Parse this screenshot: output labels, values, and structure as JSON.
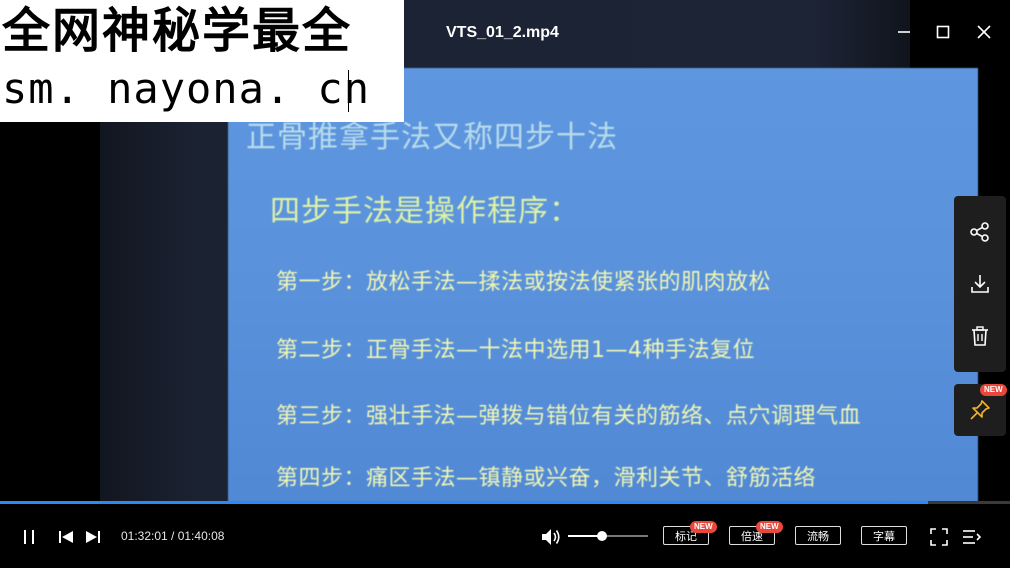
{
  "window": {
    "file_title": "VTS_01_2.mp4",
    "minimize_icon": "minimize-icon",
    "maximize_icon": "maximize-icon",
    "close_icon": "close-icon"
  },
  "watermark": {
    "line1": "全网神秘学最全",
    "line2": "sm. nayona. cn"
  },
  "slide": {
    "title": "正骨推拿手法又称四步十法",
    "subtitle": "四步手法是操作程序：",
    "steps": [
      "第一步：放松手法—揉法或按法使紧张的肌肉放松",
      "第二步：正骨手法—十法中选用1—4种手法复位",
      "第三步：强壮手法—弹拨与错位有关的筋络、点穴调理气血",
      "第四步：痛区手法—镇静或兴奋，滑利关节、舒筋活络"
    ]
  },
  "side_panel": {
    "share_icon": "share-icon",
    "download_icon": "download-icon",
    "delete_icon": "trash-icon",
    "pin_icon": "pin-icon",
    "pin_badge": "NEW"
  },
  "playback": {
    "current_time": "01:32:01",
    "total_time": "01:40:08",
    "time_text": "01:32:01 / 01:40:08",
    "progress_fraction": 0.919,
    "volume_fraction": 0.42
  },
  "controls": {
    "pause_icon": "pause-icon",
    "prev_icon": "previous-icon",
    "next_icon": "next-icon",
    "volume_icon": "volume-icon",
    "mark_label": "标记",
    "mark_badge": "NEW",
    "speed_label": "倍速",
    "speed_badge": "NEW",
    "quality_label": "流畅",
    "subtitle_label": "字幕",
    "fullscreen_icon": "fullscreen-icon",
    "playlist_icon": "playlist-icon"
  },
  "colors": {
    "accent": "#2a8bf2",
    "badge": "#e8483b",
    "slide_bg": "#5a92dc"
  }
}
